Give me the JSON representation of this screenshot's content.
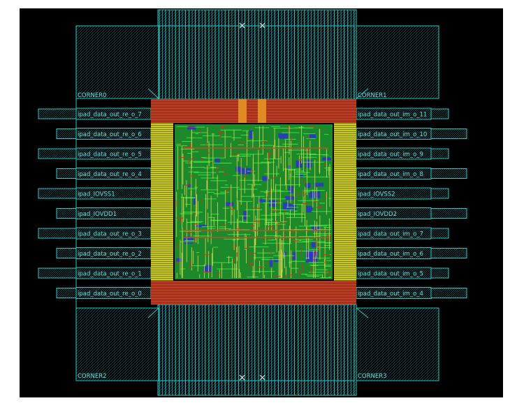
{
  "colors": {
    "background": "#000000",
    "outline": "#29c7c7",
    "label": "#5fe6e6",
    "power_ring": "#a8301f",
    "rail": "#d6d62a",
    "stdcell_fill": "#1a9a2c",
    "wire_green": "#38e83a",
    "wire_yellow": "#d8d850",
    "wire_red": "#e02a1c",
    "wire_blue": "#2b2ed8",
    "bond_wire": "#2aa7c0",
    "marker": "#e8e8e8"
  },
  "corners": {
    "top_left": "CORNER0",
    "top_right": "CORNER1",
    "bottom_left": "CORNER2",
    "bottom_right": "CORNER3"
  },
  "left_pads": [
    "ipad_data_out_re_o_7",
    "ipad_data_out_re_o_6",
    "ipad_data_out_re_o_5",
    "ipad_data_out_re_o_4",
    "ipad_IOVSS1",
    "ipad_IOVDD1",
    "ipad_data_out_re_o_3",
    "ipad_data_out_re_o_2",
    "ipad_data_out_re_o_1",
    "ipad_data_out_re_o_0"
  ],
  "right_pads": [
    "ipad_data_out_im_o_11",
    "ipad_data_out_im_o_10",
    "ipad_data_out_im_o_9",
    "ipad_data_out_im_o_8",
    "ipad_IOVSS2",
    "ipad_IOVDD2",
    "ipad_data_out_im_o_7",
    "ipad_data_out_im_o_6",
    "ipad_data_out_im_o_5",
    "ipad_data_out_im_o_4"
  ]
}
